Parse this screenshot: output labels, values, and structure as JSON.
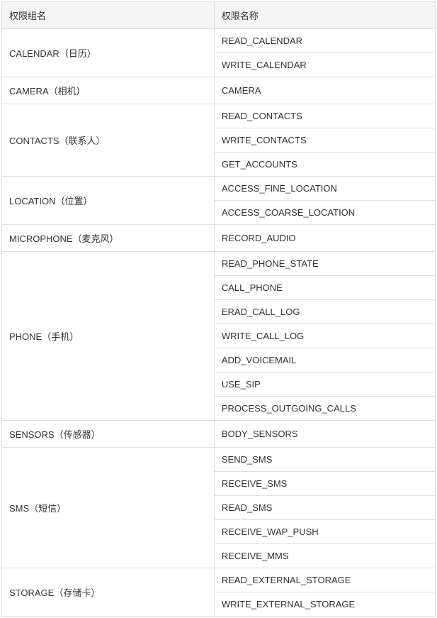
{
  "headers": {
    "group": "权限组名",
    "permission": "权限名称"
  },
  "groups": [
    {
      "name": "CALENDAR（日历）",
      "permissions": [
        "READ_CALENDAR",
        "WRITE_CALENDAR"
      ]
    },
    {
      "name": "CAMERA（相机）",
      "permissions": [
        "CAMERA"
      ]
    },
    {
      "name": "CONTACTS（联系人）",
      "permissions": [
        "READ_CONTACTS",
        "WRITE_CONTACTS",
        "GET_ACCOUNTS"
      ]
    },
    {
      "name": "LOCATION（位置）",
      "permissions": [
        "ACCESS_FINE_LOCATION",
        "ACCESS_COARSE_LOCATION"
      ]
    },
    {
      "name": "MICROPHONE（麦克风）",
      "permissions": [
        "RECORD_AUDIO"
      ]
    },
    {
      "name": "PHONE（手机）",
      "permissions": [
        "READ_PHONE_STATE",
        "CALL_PHONE",
        "ERAD_CALL_LOG",
        "WRITE_CALL_LOG",
        "ADD_VOICEMAIL",
        "USE_SIP",
        "PROCESS_OUTGOING_CALLS"
      ]
    },
    {
      "name": "SENSORS（传感器）",
      "permissions": [
        "BODY_SENSORS"
      ]
    },
    {
      "name": "SMS（短信）",
      "permissions": [
        "SEND_SMS",
        "RECEIVE_SMS",
        "READ_SMS",
        "RECEIVE_WAP_PUSH",
        "RECEIVE_MMS"
      ]
    },
    {
      "name": "STORAGE（存储卡）",
      "permissions": [
        "READ_EXTERNAL_STORAGE",
        "WRITE_EXTERNAL_STORAGE"
      ]
    }
  ]
}
